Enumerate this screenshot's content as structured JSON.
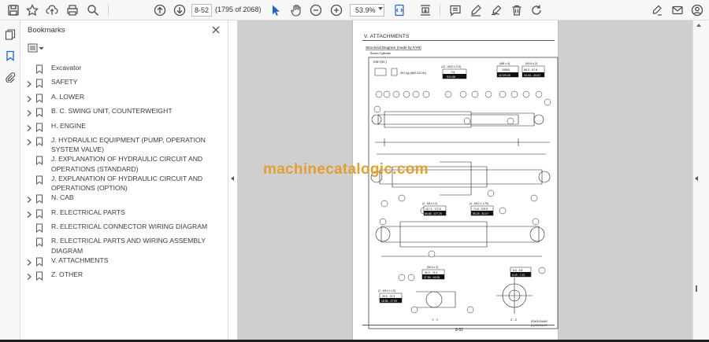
{
  "toolbar": {
    "page_current": "8-52",
    "page_count": "(1795 of 2068)",
    "zoom": "53.9%"
  },
  "bookmarks_panel": {
    "title": "Bookmarks",
    "items": [
      {
        "label": "Excavator",
        "expandable": false
      },
      {
        "label": "SAFETY",
        "expandable": true
      },
      {
        "label": "A. LOWER",
        "expandable": true
      },
      {
        "label": "B. C. SWING UNIT, COUNTERWEIGHT",
        "expandable": true
      },
      {
        "label": "H. ENGINE",
        "expandable": true
      },
      {
        "label": "J. HYDRAULIC EQUIPMENT (PUMP, OPERATION SYSTEM VALVE)",
        "expandable": true
      },
      {
        "label": "J. EXPLANATION OF HYDRAULIC CIRCUIT AND OPERATIONS (STANDARD)",
        "expandable": false
      },
      {
        "label": "J. EXPLANATION OF HYDRAULIC CIRCUIT AND OPERATIONS (OPTION)",
        "expandable": false
      },
      {
        "label": "N. CAB",
        "expandable": true
      },
      {
        "label": "R. ELECTRICAL PARTS",
        "expandable": true
      },
      {
        "label": "R. ELECTRICAL CONNECTOR WIRING DIAGRAM",
        "expandable": false
      },
      {
        "label": "R. ELECTRICAL PARTS AND WIRING ASSEMBLY DIAGRAM",
        "expandable": false
      },
      {
        "label": "V. ATTACHMENTS",
        "expandable": true
      },
      {
        "label": "Z. OTHER",
        "expandable": true
      }
    ]
  },
  "document": {
    "section_header": "V. ATTACHMENTS",
    "diagram_title": "Structural Diagram (made by KYB)",
    "diagram_subtitle": "Boom Cylinder",
    "unit_label": "mm (in.)",
    "weight_label": "391 kg (862.012 lb)",
    "spec_m12": "(12 - M22 x 2.5)",
    "spec_m12_values": [
      "711",
      "524.58"
    ],
    "spec_m8": "(M8 x 4)",
    "spec_m8_values": [
      "15500",
      "11729.25"
    ],
    "spec_m14": "(M14 x 2)",
    "spec_m14_values": [
      "66.3 - 67.6",
      "34.00 - 49.87"
    ],
    "spec_4_m14": "(4 - M14 x 2)",
    "spec_4_m14_values": [
      "117.3 - 172.5",
      "86.88 - 127.25"
    ],
    "spec_4_m12": "(4 - M12 x 1.75)",
    "spec_4_m12_values": [
      "74.5 - 109.8",
      "55.25 - 81.07"
    ],
    "spec_m14_lower": "(M14 x 2)",
    "spec_m14_lower_values": [
      "50.9 - 74.5",
      "37.55 - 54.95"
    ],
    "spec_2_m10": "(2 - M10 x 1.5)",
    "spec_2_m10_values": [
      "25.5 - 37.3",
      "18.86 - 27.59"
    ],
    "spec_small_values": [
      "8.8 - 9.8",
      "6.49 - 7.22"
    ],
    "view_labels": [
      "Y - Y",
      "Z - Z"
    ],
    "model_codes": [
      "(R)KSV34460",
      "(L)KSV34470"
    ],
    "page_number": "8-52"
  },
  "watermark": "machinecatalogic.com",
  "colors": {
    "toolbar_bg": "#f7f7f7",
    "viewer_bg": "#cfcfcf",
    "watermark": "#e3a030"
  }
}
